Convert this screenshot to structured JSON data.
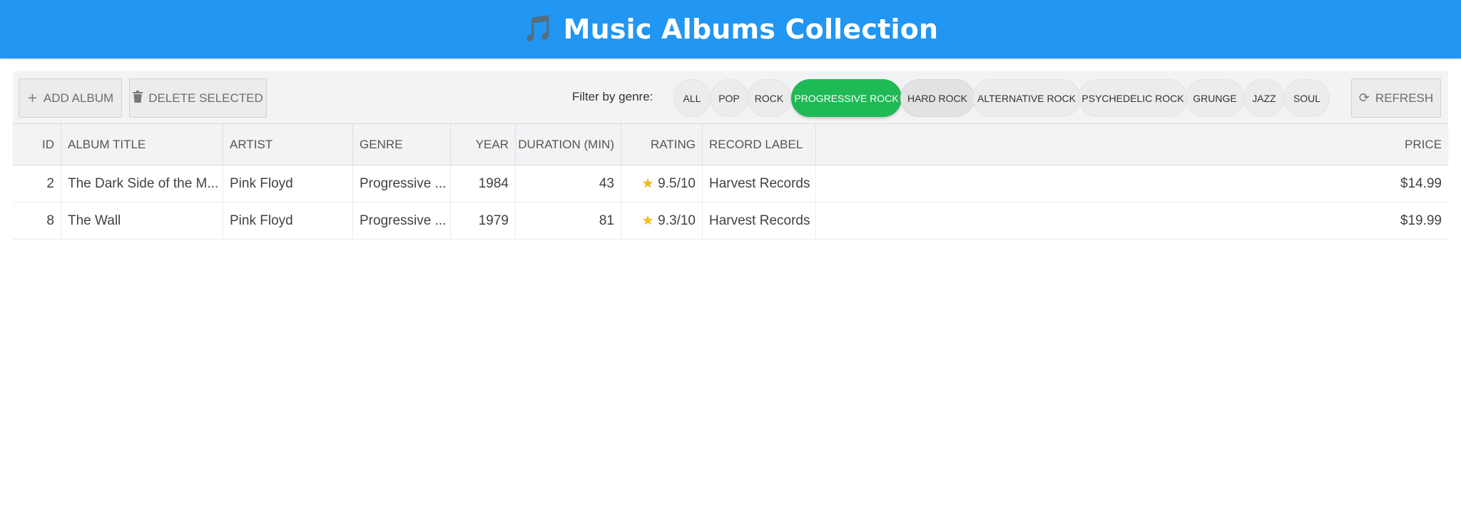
{
  "header": {
    "icon": "music-note-icon",
    "note_glyph": "🎵",
    "title": "Music Albums Collection"
  },
  "toolbar": {
    "add_label": "ADD ALBUM",
    "delete_label": "DELETE SELECTED",
    "refresh_label": "REFRESH",
    "filter_label": "Filter by genre:",
    "genres": [
      "ALL",
      "POP",
      "ROCK",
      "PROGRESSIVE ROCK",
      "HARD ROCK",
      "ALTERNATIVE ROCK",
      "PSYCHEDELIC ROCK",
      "GRUNGE",
      "JAZZ",
      "SOUL"
    ],
    "active_genre": "PROGRESSIVE ROCK"
  },
  "table": {
    "columns": [
      "ID",
      "ALBUM TITLE",
      "ARTIST",
      "GENRE",
      "YEAR",
      "DURATION (MIN)",
      "RATING",
      "RECORD LABEL",
      "PRICE"
    ],
    "rows": [
      {
        "id": "2",
        "title": "The Dark Side of the M...",
        "artist": "Pink Floyd",
        "genre": "Progressive ...",
        "year": "1984",
        "duration": "43",
        "rating": "9.5/10",
        "label": "Harvest Records",
        "price": "$14.99"
      },
      {
        "id": "8",
        "title": "The Wall",
        "artist": "Pink Floyd",
        "genre": "Progressive ...",
        "year": "1979",
        "duration": "81",
        "rating": "9.3/10",
        "label": "Harvest Records",
        "price": "$19.99"
      }
    ]
  },
  "colors": {
    "header": "#2196f3",
    "active_chip": "#1fb955",
    "star": "#f4c20d"
  }
}
